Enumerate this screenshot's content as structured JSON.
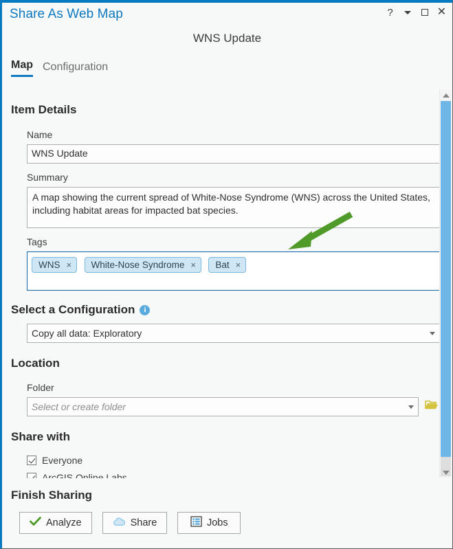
{
  "window": {
    "title": "Share As Web Map",
    "subtitle": "WNS Update",
    "controls": [
      {
        "name": "help-button",
        "glyph": "?"
      },
      {
        "name": "dropdown-button",
        "glyph": "caret"
      },
      {
        "name": "restore-button",
        "glyph": "square"
      },
      {
        "name": "close-button",
        "glyph": "×"
      }
    ]
  },
  "tabs": [
    {
      "label": "Map",
      "active": true
    },
    {
      "label": "Configuration",
      "active": false
    }
  ],
  "item_details": {
    "heading": "Item Details",
    "name_label": "Name",
    "name_value": "WNS Update",
    "name_placeholder": "",
    "summary_label": "Summary",
    "summary_value": "A map showing the current spread of White-Nose Syndrome (WNS) across the United States, including habitat areas for impacted bat species.",
    "tags_label": "Tags",
    "tags": [
      {
        "label": "WNS",
        "remove": "×"
      },
      {
        "label": "White-Nose Syndrome",
        "remove": "×"
      },
      {
        "label": "Bat",
        "remove": "×"
      }
    ]
  },
  "configuration": {
    "heading": "Select a Configuration",
    "info_icon": "info-icon",
    "selected": "Copy all data: Exploratory"
  },
  "location": {
    "heading": "Location",
    "folder_label": "Folder",
    "folder_placeholder": "Select or create folder",
    "folder_value": "",
    "browse_icon": "folder-icon"
  },
  "share_with": {
    "heading": "Share with",
    "options": [
      {
        "label": "Everyone",
        "checked": true
      },
      {
        "label": "ArcGIS Online Labs",
        "checked": true
      }
    ]
  },
  "finish_sharing": {
    "heading": "Finish Sharing",
    "buttons": [
      {
        "label": "Analyze",
        "icon": "check-icon"
      },
      {
        "label": "Share",
        "icon": "cloud-icon"
      },
      {
        "label": "Jobs",
        "icon": "list-icon"
      }
    ]
  },
  "annotation": {
    "type": "arrow",
    "color": "#4f9a29",
    "points_to": "tags-box"
  },
  "colors": {
    "accent": "#0a7ac0",
    "title_text": "#0e79c0",
    "arrow_green": "#4f9a29",
    "tag_bg": "#cfe7f5",
    "tag_border": "#7ab7de",
    "scrollbar_thumb": "#6db6e5",
    "folder_yellow": "#d4c340",
    "check_green": "#4e9a28",
    "cloud_blue": "#8fc9e8"
  },
  "scrollbar": {
    "orientation": "vertical",
    "thumb_position_percent": 0
  }
}
